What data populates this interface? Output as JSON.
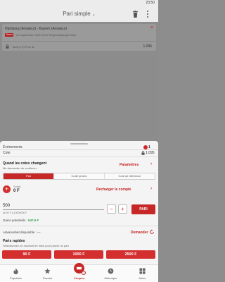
{
  "status": {
    "time": "23:50"
  },
  "header": {
    "title": "Pari simple",
    "caret": "⌄"
  },
  "bet": {
    "match": "Hamburg (Amateur) - Bayern (Amateur)",
    "badge": "Direct",
    "date": "21 septembre 2023 03:30 Regionalliga germany",
    "pick": "Total (2.5) Plus de",
    "odd": "1.095",
    "close": "×"
  },
  "summary": {
    "events_label": "Événements",
    "events_count": "1",
    "cote_label": "Cote",
    "cote_value": "1.095"
  },
  "odds_change": {
    "title": "Quand les cotes changent",
    "subtitle": "Me demander de confirmer",
    "params": "Paramètres",
    "chevron": "›"
  },
  "tabs": [
    {
      "label": "Pari",
      "active": true
    },
    {
      "label": "Code promo",
      "active": false
    },
    {
      "label": "Cote de référence",
      "active": false
    }
  ],
  "balance": {
    "label": "Solde:",
    "value": "0 F",
    "recharge": "Recharger le compte",
    "add": "+"
  },
  "stake": {
    "value": "500",
    "hint": "de 50 F à 14000000 F",
    "minus": "−",
    "plus": "+",
    "submit": "PARI"
  },
  "gains": {
    "label": "Gains potentiels :",
    "value": "547.5 F"
  },
  "advance": {
    "label": "Advancebet disponible : —",
    "action": "Demander"
  },
  "quick": {
    "title": "Paris rapides",
    "subtitle": "Sélectionnez un montant de mise pour placer un pari",
    "amounts": [
      "90 F",
      "1000 F",
      "2500 F"
    ]
  },
  "nav": [
    {
      "label": "Populaire",
      "icon": "fire-icon"
    },
    {
      "label": "Favoris",
      "icon": "star-icon"
    },
    {
      "label": "Coupon",
      "icon": "ticket-icon",
      "badge": "1"
    },
    {
      "label": "Historique",
      "icon": "clock-icon"
    },
    {
      "label": "Menu",
      "icon": "grid-icon"
    }
  ]
}
